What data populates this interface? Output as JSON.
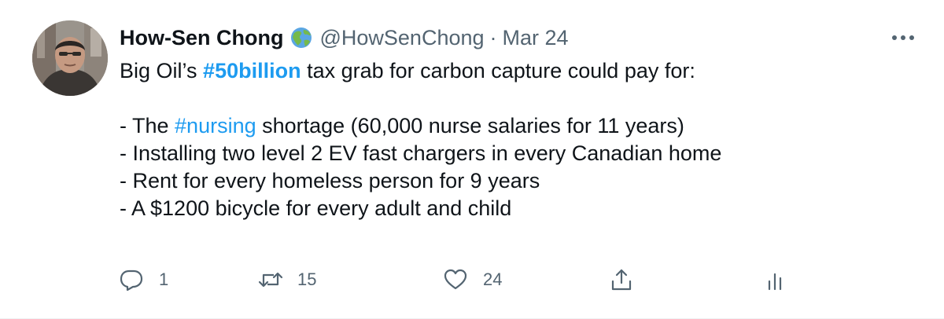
{
  "tweet": {
    "author": {
      "display_name": "How-Sen Chong",
      "badge_icon": "globe-americas-icon",
      "handle": "@HowSenChong"
    },
    "separator": "·",
    "date": "Mar 24",
    "more_icon": "ellipsis-icon",
    "text": {
      "line1": {
        "before": "Big Oil’s ",
        "hashtag": "#50billion",
        "after": " tax grab for carbon capture could pay for:"
      },
      "line3": {
        "before": "- The ",
        "hashtag": "#nursing",
        "after": " shortage (60,000 nurse salaries for 11 years)"
      },
      "line4": "- Installing two level 2 EV fast chargers in every Canadian home",
      "line5": "- Rent for every homeless person for 9 years",
      "line6": "- A $1200 bicycle for every adult and child"
    },
    "actions": {
      "reply": {
        "icon": "reply-icon",
        "count": "1"
      },
      "retweet": {
        "icon": "retweet-icon",
        "count": "15"
      },
      "like": {
        "icon": "heart-icon",
        "count": "24"
      },
      "share": {
        "icon": "share-icon"
      },
      "analytics": {
        "icon": "analytics-icon"
      }
    },
    "colors": {
      "link": "#1d9bf0",
      "secondary_text": "#536471",
      "primary_text": "#0f1419"
    }
  }
}
